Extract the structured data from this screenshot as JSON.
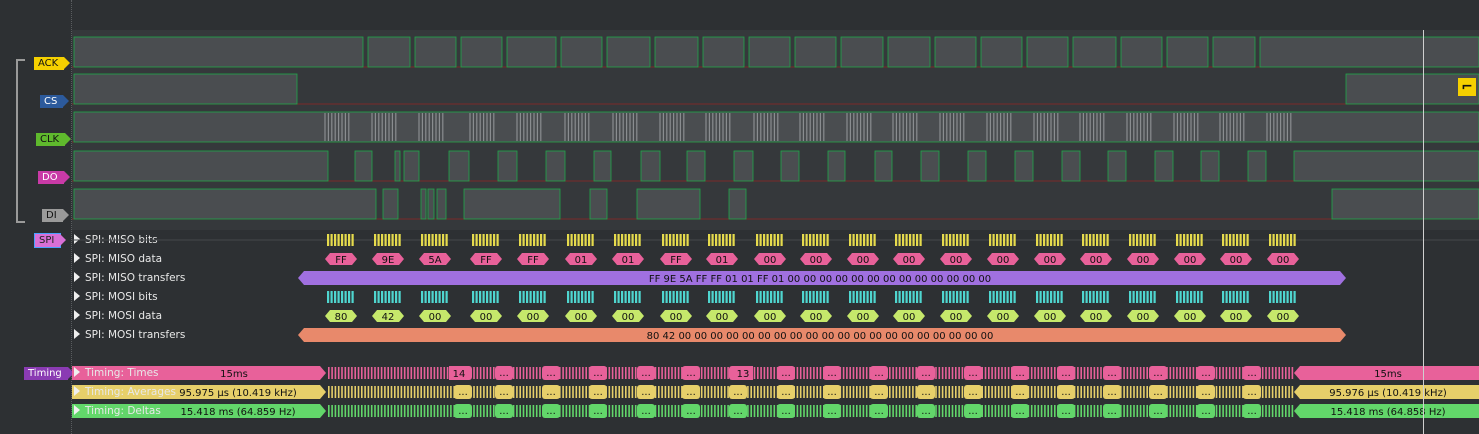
{
  "channels": [
    {
      "label": "ACK"
    },
    {
      "label": "CS"
    },
    {
      "label": "CLK"
    },
    {
      "label": "DO"
    },
    {
      "label": "DI"
    }
  ],
  "spi_tag": "SPI",
  "timing_tag": "Timing",
  "spi_rows": [
    {
      "label": "SPI: MISO bits"
    },
    {
      "label": "SPI: MISO data"
    },
    {
      "label": "SPI: MISO transfers"
    },
    {
      "label": "SPI: MOSI bits"
    },
    {
      "label": "SPI: MOSI data"
    },
    {
      "label": "SPI: MOSI transfers"
    }
  ],
  "miso_bytes": [
    "FF",
    "9E",
    "5A",
    "FF",
    "FF",
    "01",
    "01",
    "FF",
    "01",
    "00",
    "00",
    "00",
    "00",
    "00",
    "00",
    "00",
    "00",
    "00",
    "00",
    "00",
    "00",
    "00"
  ],
  "mosi_bytes": [
    "80",
    "42",
    "00",
    "00",
    "00",
    "00",
    "00",
    "00",
    "00",
    "00",
    "00",
    "00",
    "00",
    "00",
    "00",
    "00",
    "00",
    "00",
    "00",
    "00",
    "00",
    "00"
  ],
  "miso_transfer_text": "FF 9E 5A FF FF 01 01 FF 01 00 00 00 00 00 00 00 00 00 00 00 00 00",
  "mosi_transfer_text": "80 42 00 00 00 00 00 00 00 00 00 00 00 00 00 00 00 00 00 00 00 00",
  "timing_rows": [
    {
      "label": "Timing: Times",
      "left_value": "15ms",
      "right_value": "15ms",
      "mid_values": [
        "14",
        "13"
      ],
      "color": "#e8619a"
    },
    {
      "label": "Timing: Averages",
      "left_value": "95.975 µs (10.419 kHz)",
      "right_value": "95.976 µs (10.419 kHz)",
      "color": "#e6cf6a"
    },
    {
      "label": "Timing: Deltas",
      "left_value": "15.418 ms (64.859 Hz)",
      "right_value": "15.418 ms (64.858 Hz)",
      "color": "#62d66a"
    }
  ],
  "ellipsis": "...",
  "edge_icon": "falling-edge-icon",
  "colors": {
    "miso_bits": "#e6db4d",
    "miso_data": "#e8619a",
    "miso_transfer": "#a070e0",
    "mosi_bits": "#4fd6d0",
    "mosi_data": "#c6e86b",
    "mosi_transfer": "#e8896b"
  }
}
